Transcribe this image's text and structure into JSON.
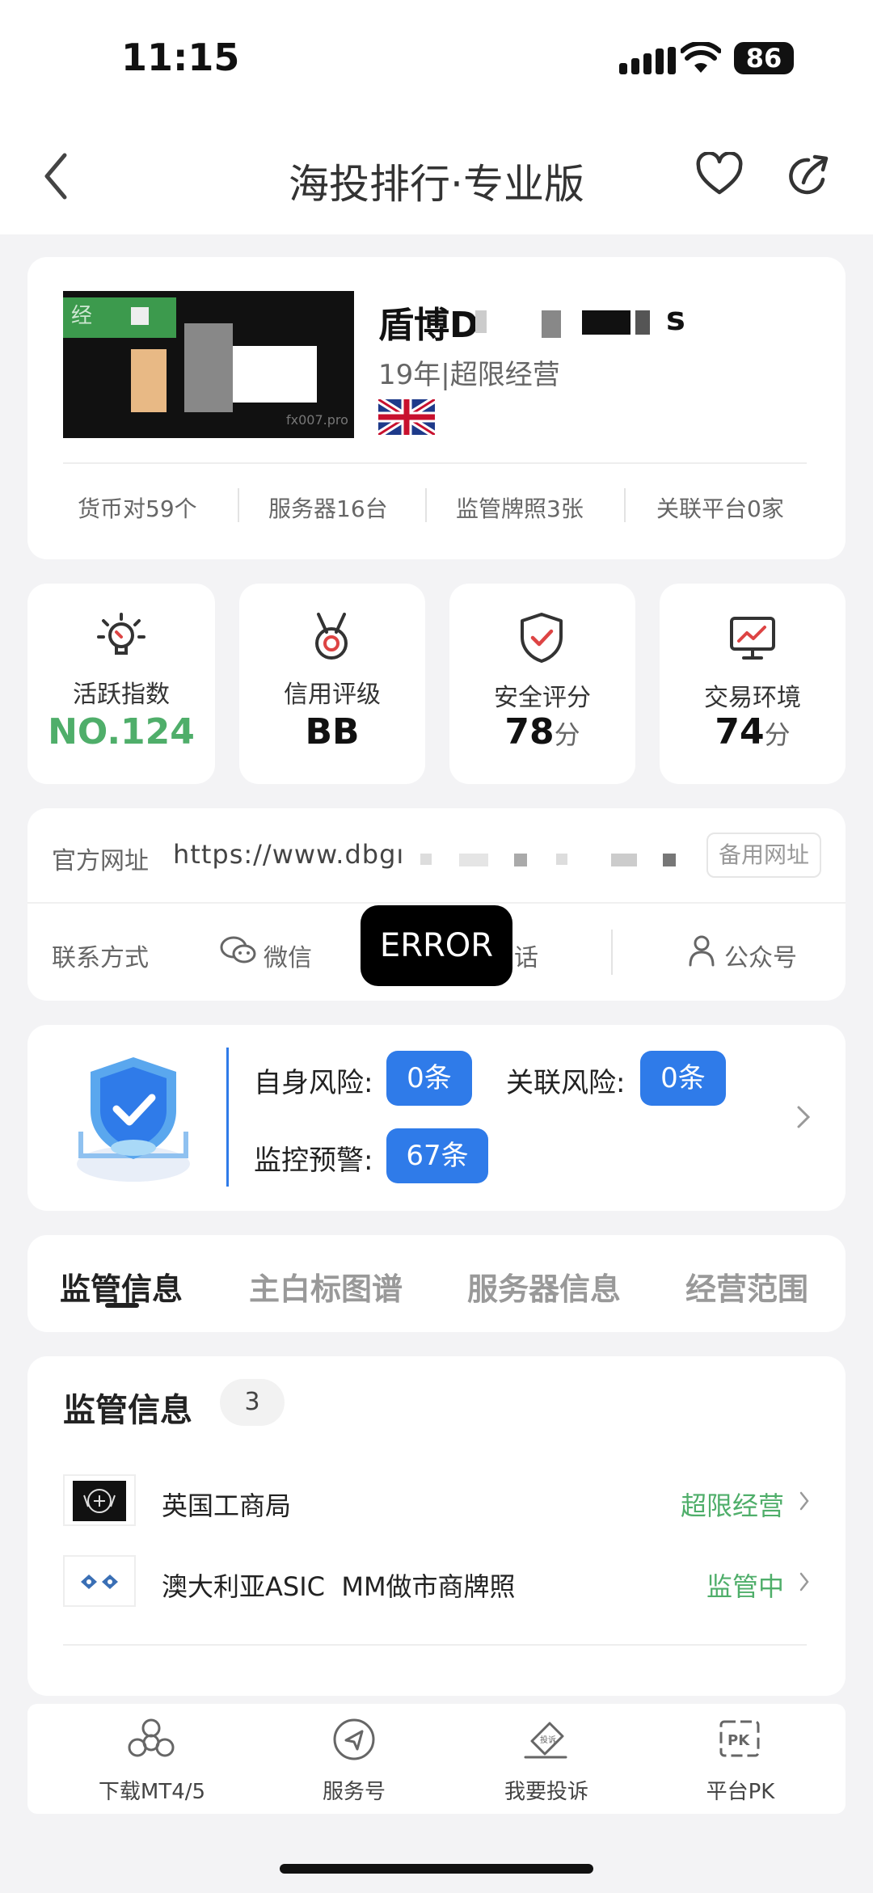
{
  "status_bar": {
    "time": "11:15",
    "battery": "86"
  },
  "nav": {
    "title": "海投排行·专业版"
  },
  "broker": {
    "name": "盾博D",
    "name_tail": "s",
    "info": "19年|超限经营",
    "badge": "经",
    "watermark": "fx007.pro",
    "stats": [
      "货币对59个",
      "服务器16台",
      "监管牌照3张",
      "关联平台0家"
    ]
  },
  "metrics": [
    {
      "label": "活跃指数",
      "value": "NO.124",
      "unit": ""
    },
    {
      "label": "信用评级",
      "value": "BB",
      "unit": ""
    },
    {
      "label": "安全评分",
      "value": "78",
      "unit": "分"
    },
    {
      "label": "交易环境",
      "value": "74",
      "unit": "分"
    }
  ],
  "website": {
    "label": "官方网址",
    "url": "https://www.dbgı",
    "backup": "备用网址"
  },
  "contact": {
    "label": "联系方式",
    "wechat": "微信",
    "phone_tail": "话",
    "official": "公众号",
    "error": "ERROR"
  },
  "risk": {
    "self_label": "自身风险:",
    "self_value": "0条",
    "related_label": "关联风险:",
    "related_value": "0条",
    "monitor_label": "监控预警:",
    "monitor_value": "67条"
  },
  "tabs": [
    "监管信息",
    "主白标图谱",
    "服务器信息",
    "经营范围"
  ],
  "regulation": {
    "title": "监管信息",
    "count": "3",
    "items": [
      {
        "name": "英国工商局",
        "status": "超限经营"
      },
      {
        "name": "澳大利亚ASIC  MM做市商牌照",
        "status": "监管中"
      }
    ]
  },
  "bottom_nav": [
    "下载MT4/5",
    "服务号",
    "我要投诉",
    "平台PK"
  ],
  "colors": {
    "accent_blue": "#2f7be9",
    "green": "#4fae6a"
  }
}
